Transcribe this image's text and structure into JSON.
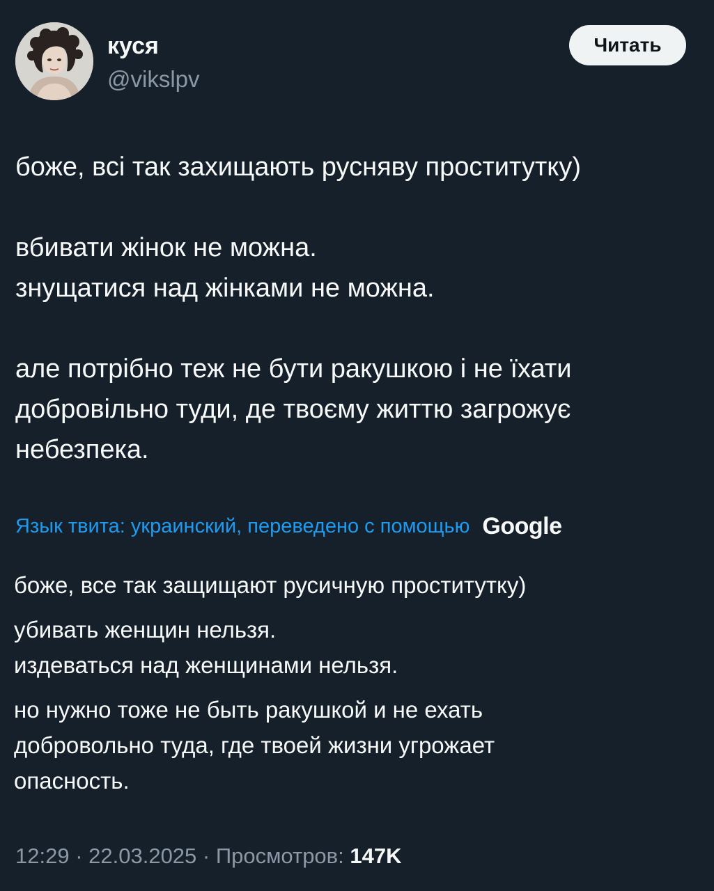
{
  "author": {
    "name": "куся",
    "handle": "@vikslpv",
    "avatar_icon": "profile-photo"
  },
  "actions": {
    "read_label": "Читать"
  },
  "tweet": {
    "paragraphs": [
      [
        "боже, всі так захищають русняву проститутку)"
      ],
      [
        "вбивати жінок не можна.",
        "знущатися над жінками не можна."
      ],
      [
        "але потрібно теж не бути ракушкою  і не їхати",
        "добровільно туди, де твоєму життю загрожує",
        "небезпека."
      ]
    ]
  },
  "translation": {
    "note": "Язык твита: украинский, переведено с помощью",
    "provider": "Google",
    "paragraphs": [
      [
        "боже, все так защищают русичную проститутку)"
      ],
      [
        "убивать женщин нельзя.",
        "издеваться над женщинами нельзя."
      ],
      [
        "но нужно тоже не быть ракушкой и не ехать",
        "добровольно туда, где твоей жизни угрожает",
        "опасность."
      ]
    ]
  },
  "meta": {
    "time": "12:29",
    "date": "22.03.2025",
    "separator": " · ",
    "views_label": "Просмотров:",
    "views_count": "147K"
  },
  "colors": {
    "background": "#15202b",
    "text": "#f7f9f9",
    "secondary": "#8b98a5",
    "link": "#1d9bf0",
    "button_bg": "#eff3f4"
  }
}
